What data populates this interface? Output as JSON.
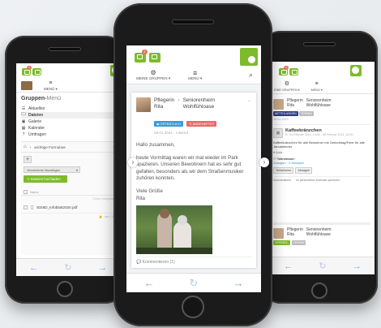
{
  "colors": {
    "accent": "#7dbb2a",
    "badge": "#e8735f",
    "link": "#3a9bd9",
    "tag_red": "#e86a6a",
    "tag_navy": "#2c3e80"
  },
  "left_phone": {
    "topbar": {
      "badge_count": "1"
    },
    "nav": {
      "menu_label": "MENÜ ▾"
    },
    "section_title": "Gruppen-",
    "section_title_suffix": "Menü",
    "menu_items": [
      {
        "icon": "list-icon",
        "label": "Aktuelles"
      },
      {
        "icon": "folder-icon",
        "label": "Dateien"
      },
      {
        "icon": "image-icon",
        "label": "Galerie"
      },
      {
        "icon": "calendar-icon",
        "label": "Kalender"
      },
      {
        "icon": "question-icon",
        "label": "Umfragen"
      }
    ],
    "breadcrumb": "wichtige Formulare",
    "add_button": "+",
    "folder_select": "Verzeichnis hinzufügen",
    "upload_button": "Dateien hochladen",
    "column_name": "Name",
    "row_meta": "Größe  Hochgeladen",
    "file_name": "EtS6D_Infoblatt2020.pdf",
    "file_meta": "vor 1 Jahr"
  },
  "center_phone": {
    "topbar": {
      "badge_count": "1"
    },
    "nav": {
      "groups_label": "MEINE GRUPPEN ▾",
      "menu_label": "MENÜ ▾"
    },
    "post": {
      "author_first": "Pflegerin",
      "author_last": "Rita",
      "arrow": "›",
      "group_line1": "Seniorenheim",
      "group_line2": "Wohlfühloase",
      "tag_public": "ÖFFENTLICH",
      "tag_pinned": "ANGEHEFTET",
      "timestamp": "28.01.2021",
      "status": "Listend",
      "greeting": "Hallo zusammen,",
      "body": "heute Vormittag waren wir mal wieder im Park spazieren. Unseren Bewohnern hat es sehr gut gefallen, besonders als wir dem Straßenmusiker zuhören konnten.",
      "closing_1": "Viele Grüße",
      "closing_2": "Rita",
      "comments_label": "Kommentieren (1)"
    }
  },
  "right_phone": {
    "topbar": {
      "badge_count": "1"
    },
    "nav": {
      "groups_label": "EINE GRUPPEN ▾",
      "menu_label": "MENÜ ▾"
    },
    "post1": {
      "author_first": "Pflegerin",
      "author_last": "Rita",
      "group_line1": "Seniorenheim",
      "group_line2": "Wohlfühloase",
      "tag_1": "MITTEILUNGEN",
      "tag_2": "TERMIN",
      "timestamp": "28.01.2021",
      "event_title": "Kaffeekränzchen",
      "event_time": "Fr. 04 Februar 2021, 14:00 - 08 Februar 2021, 16:00",
      "event_desc": "Kaffeekränzchen für alle Bewohner mit Geburtstag/Feier für alle Januarkinder",
      "location": "Aula",
      "participants_label": "Teilnehmer:",
      "participants_value": "Zusagen · 0 Absagen",
      "btn_accept": "Teilnehmen",
      "btn_decline": "Absagen",
      "option_1": "Kommentieren",
      "option_2": "Im persönlichen Kalender speichern"
    },
    "post2": {
      "author_first": "Pflegerin",
      "author_last": "Rita",
      "group_line1": "Seniorenheim",
      "group_line2": "Wohlfühloase",
      "tag_1": "ÖFFENTL.",
      "tag_2": "TERMIN"
    }
  },
  "bottom_nav": {
    "back": "←",
    "reload": "↻",
    "forward": "→"
  }
}
